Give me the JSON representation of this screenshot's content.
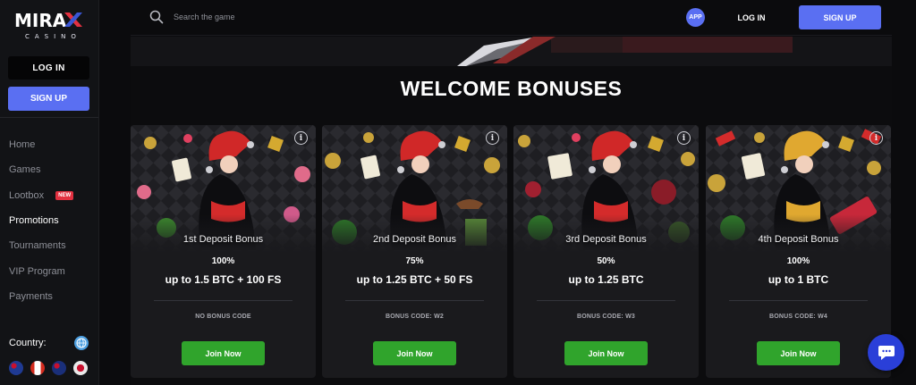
{
  "brand": {
    "logo_main": "MIRAX",
    "logo_sub": "CASINO"
  },
  "sidebar": {
    "login_label": "LOG IN",
    "signup_label": "SIGN UP",
    "items": [
      {
        "label": "Home",
        "active": false
      },
      {
        "label": "Games",
        "active": false
      },
      {
        "label": "Lootbox",
        "active": false,
        "badge": "NEW"
      },
      {
        "label": "Promotions",
        "active": true
      },
      {
        "label": "Tournaments",
        "active": false
      },
      {
        "label": "VIP Program",
        "active": false
      },
      {
        "label": "Payments",
        "active": false
      }
    ],
    "country_label": "Country:",
    "flags": [
      "australia-flag-icon",
      "canada-flag-icon",
      "new-zealand-flag-icon",
      "other-flag-icon"
    ]
  },
  "topbar": {
    "search_placeholder": "Search the game",
    "app_label": "APP",
    "login_label": "LOG IN",
    "signup_label": "SIGN UP"
  },
  "main": {
    "title": "WELCOME BONUSES",
    "cards": [
      {
        "name": "1st Deposit Bonus",
        "percent": "100%",
        "amount": "up to 1.5 BTC + 100 FS",
        "code": "NO BONUS CODE",
        "button": "Join Now",
        "theme": "red"
      },
      {
        "name": "2nd Deposit Bonus",
        "percent": "75%",
        "amount": "up to 1.25 BTC + 50 FS",
        "code": "BONUS CODE: W2",
        "button": "Join Now",
        "theme": "red"
      },
      {
        "name": "3rd Deposit Bonus",
        "percent": "50%",
        "amount": "up to 1.25 BTC",
        "code": "BONUS CODE: W3",
        "button": "Join Now",
        "theme": "red"
      },
      {
        "name": "4th Deposit Bonus",
        "percent": "100%",
        "amount": "up to 1 BTC",
        "code": "BONUS CODE: W4",
        "button": "Join Now",
        "theme": "gold"
      }
    ]
  },
  "colors": {
    "accent": "#5a6ff2",
    "join_green": "#30a42c",
    "new_badge": "#e23040",
    "chat": "#2a3fd8"
  }
}
